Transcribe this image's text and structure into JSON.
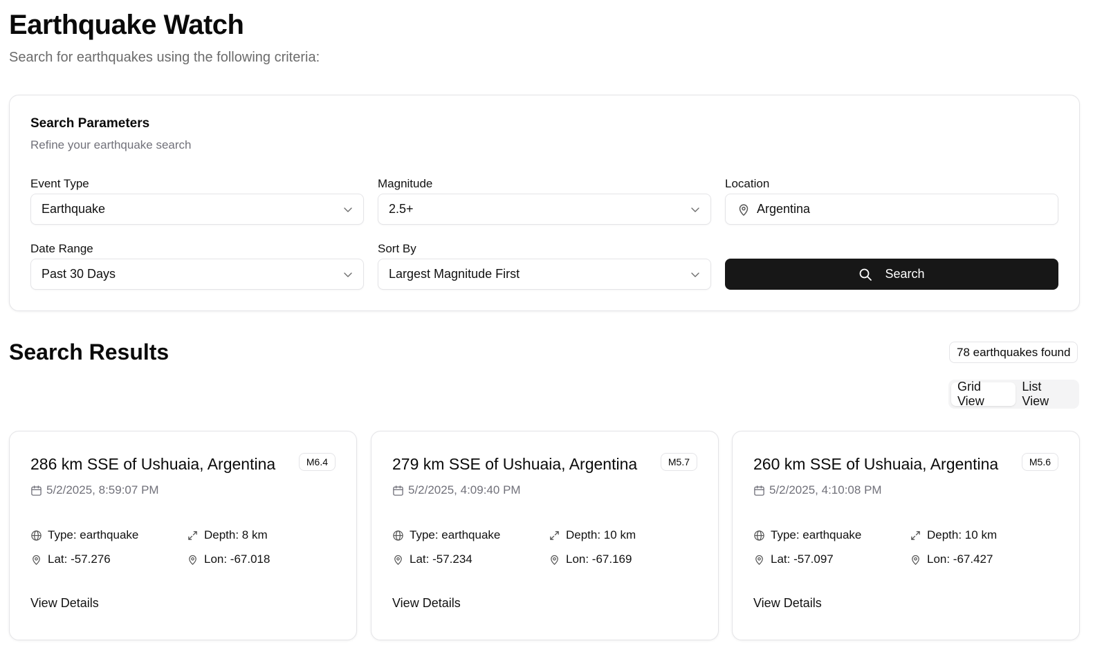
{
  "header": {
    "title": "Earthquake Watch",
    "subtitle": "Search for earthquakes using the following criteria:"
  },
  "search_panel": {
    "title": "Search Parameters",
    "subtitle": "Refine your earthquake search",
    "event_type": {
      "label": "Event Type",
      "value": "Earthquake"
    },
    "magnitude": {
      "label": "Magnitude",
      "value": "2.5+"
    },
    "location": {
      "label": "Location",
      "value": "Argentina"
    },
    "date_range": {
      "label": "Date Range",
      "value": "Past 30 Days"
    },
    "sort_by": {
      "label": "Sort By",
      "value": "Largest Magnitude First"
    },
    "search_button": "Search"
  },
  "results": {
    "title": "Search Results",
    "count": "78 earthquakes found",
    "views": {
      "grid": "Grid View",
      "list": "List View",
      "active": "grid"
    },
    "cards": [
      {
        "title": "286 km SSE of Ushuaia, Argentina",
        "magnitude": "M6.4",
        "date": "5/2/2025, 8:59:07 PM",
        "type": "Type: earthquake",
        "depth": "Depth: 8 km",
        "lat": "Lat: -57.276",
        "lon": "Lon: -67.018",
        "action": "View Details"
      },
      {
        "title": "279 km SSE of Ushuaia, Argentina",
        "magnitude": "M5.7",
        "date": "5/2/2025, 4:09:40 PM",
        "type": "Type: earthquake",
        "depth": "Depth: 10 km",
        "lat": "Lat: -57.234",
        "lon": "Lon: -67.169",
        "action": "View Details"
      },
      {
        "title": "260 km SSE of Ushuaia, Argentina",
        "magnitude": "M5.6",
        "date": "5/2/2025, 4:10:08 PM",
        "type": "Type: earthquake",
        "depth": "Depth: 10 km",
        "lat": "Lat: -57.097",
        "lon": "Lon: -67.427",
        "action": "View Details"
      }
    ]
  },
  "icons": {
    "dropdown": "chevron-down-icon",
    "location": "map-pin-icon",
    "search": "search-icon",
    "date": "calendar-icon",
    "type": "globe-icon",
    "depth": "expand-arrows-icon",
    "coords": "map-pin-icon"
  },
  "colors": {
    "primary_button": "#171717",
    "border": "#e4e4e7",
    "muted_text": "#71717a"
  }
}
